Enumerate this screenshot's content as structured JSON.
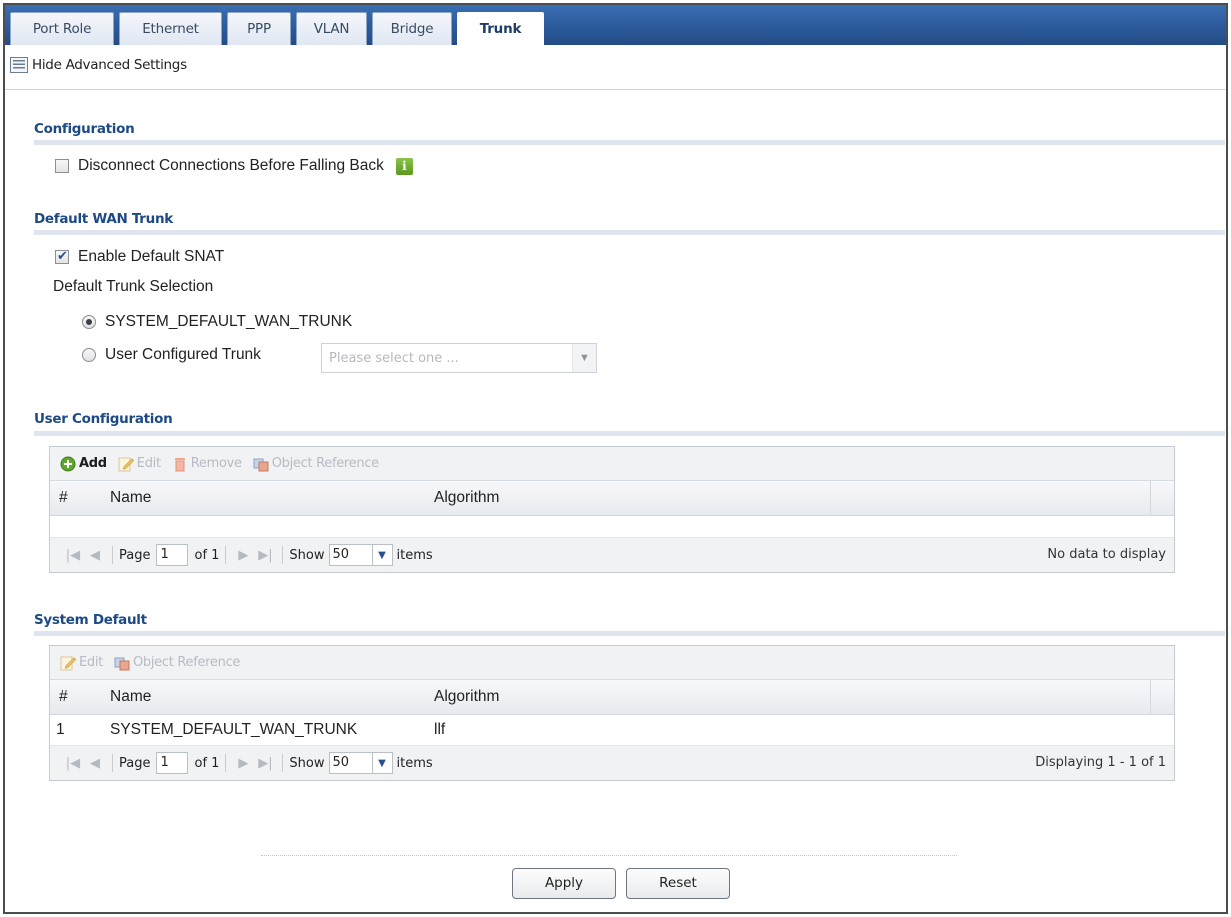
{
  "tabs": [
    {
      "label": "Port Role"
    },
    {
      "label": "Ethernet"
    },
    {
      "label": "PPP"
    },
    {
      "label": "VLAN"
    },
    {
      "label": "Bridge"
    },
    {
      "label": "Trunk",
      "active": true
    }
  ],
  "advanced_toggle": {
    "label": "Hide Advanced Settings"
  },
  "configuration": {
    "title": "Configuration",
    "disconnect_label": "Disconnect Connections Before Falling Back",
    "disconnect_checked": false
  },
  "default_wan_trunk": {
    "title": "Default WAN Trunk",
    "enable_snat_label": "Enable Default SNAT",
    "enable_snat_checked": true,
    "selection_label": "Default Trunk Selection",
    "option_system": "SYSTEM_DEFAULT_WAN_TRUNK",
    "option_user": "User Configured Trunk",
    "selected_option": "system",
    "user_trunk_placeholder": "Please select one ..."
  },
  "user_configuration": {
    "title": "User Configuration",
    "toolbar": {
      "add": "Add",
      "edit": "Edit",
      "remove": "Remove",
      "object_reference": "Object Reference"
    },
    "columns": {
      "num": "#",
      "name": "Name",
      "algorithm": "Algorithm"
    },
    "rows": [],
    "pager": {
      "page_label": "Page",
      "page_value": "1",
      "of_label": "of 1",
      "show_label": "Show",
      "show_value": "50",
      "items_label": "items",
      "status": "No data to display"
    }
  },
  "system_default": {
    "title": "System Default",
    "toolbar": {
      "edit": "Edit",
      "object_reference": "Object Reference"
    },
    "columns": {
      "num": "#",
      "name": "Name",
      "algorithm": "Algorithm"
    },
    "rows": [
      {
        "num": "1",
        "name": "SYSTEM_DEFAULT_WAN_TRUNK",
        "algorithm": "llf"
      }
    ],
    "pager": {
      "page_label": "Page",
      "page_value": "1",
      "of_label": "of 1",
      "show_label": "Show",
      "show_value": "50",
      "items_label": "items",
      "status": "Displaying 1 - 1 of 1"
    }
  },
  "buttons": {
    "apply": "Apply",
    "reset": "Reset"
  },
  "colors": {
    "tabbar": "#2c5a9a",
    "section_title": "#1d4a85",
    "info_icon": "#6aab28"
  }
}
